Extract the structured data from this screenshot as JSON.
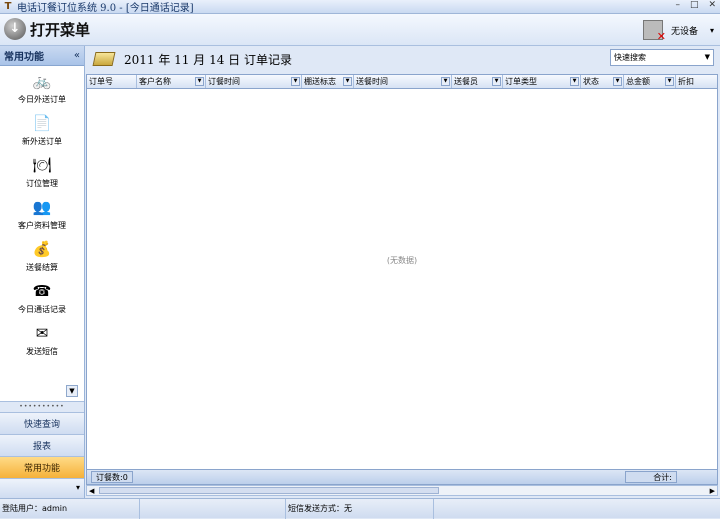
{
  "window": {
    "title": "电话订餐订位系统 9.0 - [今日通话记录]",
    "controls": [
      "–",
      "□",
      "✕"
    ]
  },
  "menubar": {
    "open_menu_label": "打开菜单",
    "device_label": "无设备",
    "device_arrow": "▾"
  },
  "sidebar": {
    "header": "常用功能",
    "collapse_glyph": "«",
    "items": [
      {
        "label": "今日外送订单",
        "icon": "bike-delivery-icon",
        "glyph": "🚲"
      },
      {
        "label": "新外送订单",
        "icon": "new-document-icon",
        "glyph": "📄"
      },
      {
        "label": "订位管理",
        "icon": "table-reservation-icon",
        "glyph": "🍽"
      },
      {
        "label": "客户资料管理",
        "icon": "customer-icon",
        "glyph": "👥"
      },
      {
        "label": "送餐结算",
        "icon": "coins-icon",
        "glyph": "💰"
      },
      {
        "label": "今日通话记录",
        "icon": "call-log-icon",
        "glyph": "☎"
      },
      {
        "label": "发送短信",
        "icon": "sms-icon",
        "glyph": "✉"
      }
    ],
    "grip": "••••••••••",
    "nav_buttons": [
      {
        "label": "快速查询"
      },
      {
        "label": "报表"
      },
      {
        "label": "常用功能"
      }
    ]
  },
  "main": {
    "title": "2011 年 11 月 14 日 订单记录",
    "quick_search": "快速搜索",
    "columns": [
      "订单号",
      "客户名称",
      "订餐时间",
      "棚送标志",
      "送餐时间",
      "送餐员",
      "订单类型",
      "状态",
      "总金额",
      "折扣"
    ],
    "empty_text": "(无数据)",
    "footer_count": "订餐数:0",
    "footer_total": "合计:"
  },
  "statusbar": {
    "user": "登陆用户：admin",
    "sms_mode": "短信发送方式：无"
  }
}
